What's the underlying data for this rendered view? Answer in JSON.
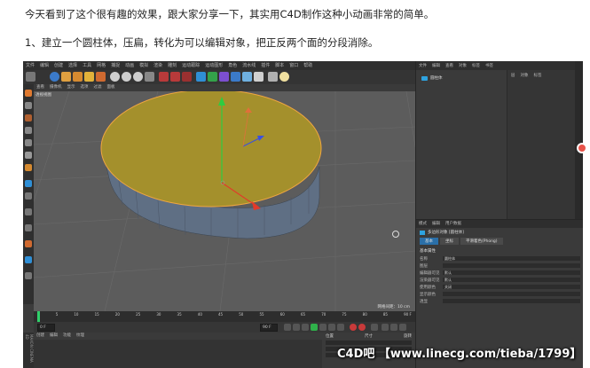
{
  "article": {
    "line1": "今天看到了这个很有趣的效果，跟大家分享一下，其实用C4D制作这种小动画非常的简单。",
    "line2": "1、建立一个圆柱体，压扁，转化为可以编辑对象，把正反两个面的分段消除。"
  },
  "watermark": "C4D吧 【www.linecg.com/tieba/1799】",
  "colors": {
    "cylinder_top": "#a4902c",
    "cylinder_side": "#5f6f84",
    "selection_edge": "#f0a640",
    "viewport_bg": "#5c5c5c",
    "accent_blue": "#2ea3e0"
  },
  "c4d": {
    "menu": [
      "文件",
      "编辑",
      "创建",
      "选择",
      "工具",
      "网格",
      "捕捉",
      "动画",
      "模拟",
      "渲染",
      "雕刻",
      "运动跟踪",
      "运动图形",
      "角色",
      "流水线",
      "插件",
      "脚本",
      "窗口",
      "帮助"
    ],
    "viewport_menu": [
      "查看",
      "摄像机",
      "显示",
      "选项",
      "过滤",
      "面板"
    ],
    "viewport_label": "透视视图",
    "grid_info": "网格间距：10 cm",
    "timeline_ticks": [
      "0",
      "5",
      "10",
      "15",
      "20",
      "25",
      "30",
      "35",
      "40",
      "45",
      "50",
      "55",
      "60",
      "65",
      "70",
      "75",
      "80",
      "85",
      "90 F"
    ],
    "frame_start": "0 F",
    "frame_end": "90 F",
    "material_menu": [
      "创建",
      "编辑",
      "功能",
      "纹理"
    ],
    "coord_headers": [
      "位置",
      "尺寸",
      "旋转"
    ],
    "side_label": "MAXON CINEMA 4D",
    "object_tabs": [
      "文件",
      "编辑",
      "查看",
      "对象",
      "标签",
      "书签"
    ],
    "object_name": "圆柱体",
    "object_right_headers": [
      "层",
      "对象",
      "标签"
    ],
    "attr_tabs": [
      "模式",
      "编辑",
      "用户数据"
    ],
    "attr_object": "多边形对象 [圆柱体]",
    "attr_subtabs": [
      "基本",
      "坐标",
      "平滑着色(Phong)"
    ],
    "attr_section": "基本属性",
    "attr_rows": [
      {
        "label": "名称",
        "value": "圆柱体"
      },
      {
        "label": "图层",
        "value": ""
      },
      {
        "label": "编辑器可见",
        "value": "默认"
      },
      {
        "label": "渲染器可见",
        "value": "默认"
      },
      {
        "label": "使用颜色",
        "value": "关闭"
      },
      {
        "label": "显示颜色",
        "value": ""
      },
      {
        "label": "透显",
        "value": ""
      }
    ]
  }
}
